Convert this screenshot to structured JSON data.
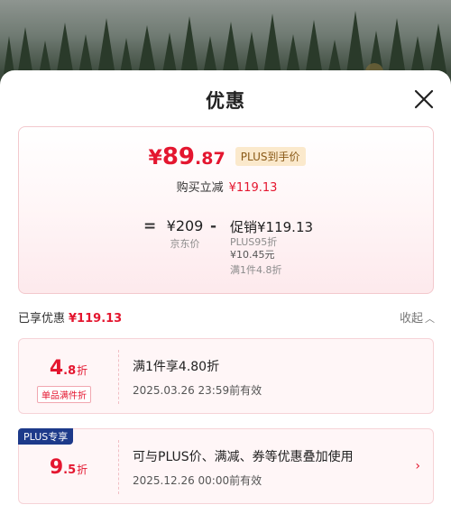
{
  "sheet": {
    "title": "优惠",
    "close_icon": "close-icon"
  },
  "price": {
    "currency": "¥",
    "integer": "89",
    "decimal": ".87",
    "plus_tag": "PLUS到手价",
    "reduce_label": "购买立减",
    "reduce_value": "¥119.13"
  },
  "formula": {
    "equals": "=",
    "original_value": "¥209",
    "original_label": "京东价",
    "minus": "-",
    "promo_value": "促销¥119.13",
    "promo_sub1": "PLUS95折",
    "promo_sub2": "¥10.45元",
    "promo_sub3": "满1件4.8折"
  },
  "enjoyed": {
    "label": "已享优惠",
    "value": "¥119.13",
    "collapse_label": "收起",
    "collapse_icon": "chevron-up-icon"
  },
  "coupons": [
    {
      "discount_big": "4",
      "discount_small": ".8",
      "unit": "折",
      "tag": "单品满件折",
      "title": "满1件享4.80折",
      "time": "2025.03.26  23:59前有效"
    },
    {
      "badge": "PLUS专享",
      "discount_big": "9",
      "discount_small": ".5",
      "unit": "折",
      "title": "可与PLUS价、满减、券等优惠叠加使用",
      "time": "2025.12.26  00:00前有效",
      "arrow_icon": "chevron-right-icon",
      "arrow": "›"
    }
  ],
  "colors": {
    "accent_red": "#e4162f",
    "plus_blue": "#1d3a8a",
    "plus_gold_bg": "#fbe9cc"
  }
}
